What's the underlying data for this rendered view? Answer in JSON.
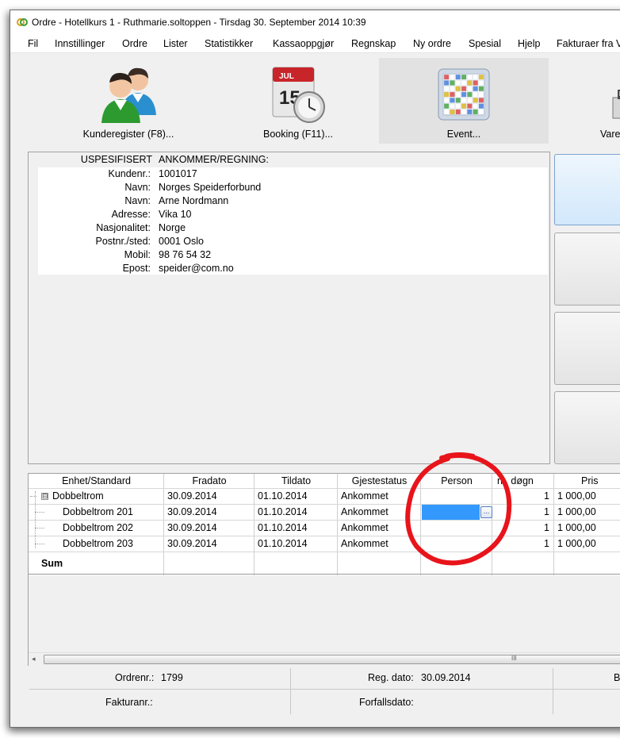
{
  "window": {
    "title": "Ordre - Hotellkurs 1 - Ruthmarie.soltoppen - Tirsdag 30. September 2014 10:39"
  },
  "menu": [
    "Fil",
    "Innstillinger",
    "Ordre",
    "Lister",
    "Statistikker",
    "Kassaoppgjør",
    "Regnskap",
    "Ny ordre",
    "Spesial",
    "Hjelp",
    "Fakturaer fra V"
  ],
  "toolbar": [
    {
      "label": "Kunderegister (F8)...",
      "icon": "users-icon"
    },
    {
      "label": "Booking (F11)...",
      "icon": "calendar-clock-icon",
      "month": "JUL",
      "day": "15"
    },
    {
      "label": "Event...",
      "icon": "event-grid-icon"
    },
    {
      "label": "Vare",
      "icon": "cash-register-icon"
    }
  ],
  "customer": {
    "header_label": "USPESIFISERT",
    "header_value": "ANKOMMER/REGNING:",
    "fields": [
      {
        "label": "Kundenr.:",
        "value": "1001017"
      },
      {
        "label": "Navn:",
        "value": "Norges Speiderforbund"
      },
      {
        "label": "Navn:",
        "value": "Arne Nordmann"
      },
      {
        "label": "Adresse:",
        "value": "Vika 10"
      },
      {
        "label": "Nasjonalitet:",
        "value": "Norge"
      },
      {
        "label": "Postnr./sted:",
        "value": "0001 Oslo"
      },
      {
        "label": "Mobil:",
        "value": "98 76 54 32"
      },
      {
        "label": "Epost:",
        "value": "speider@com.no"
      }
    ]
  },
  "grid": {
    "columns": [
      "Enhet/Standard",
      "Fradato",
      "Tildato",
      "Gjestestatus",
      "Person",
      "nt. døgn",
      "Pris"
    ],
    "rows": [
      {
        "unit": "Dobbeltrom",
        "from": "30.09.2014",
        "to": "01.10.2014",
        "status": "Ankommet",
        "person": "",
        "nights": "1",
        "price": "1 000,00"
      },
      {
        "unit": "Dobbeltrom 201",
        "from": "30.09.2014",
        "to": "01.10.2014",
        "status": "Ankommet",
        "person": "",
        "nights": "1",
        "price": "1 000,00"
      },
      {
        "unit": "Dobbeltrom 202",
        "from": "30.09.2014",
        "to": "01.10.2014",
        "status": "Ankommet",
        "person": "",
        "nights": "1",
        "price": "1 000,00"
      },
      {
        "unit": "Dobbeltrom 203",
        "from": "30.09.2014",
        "to": "01.10.2014",
        "status": "Ankommet",
        "person": "",
        "nights": "1",
        "price": "1 000,00"
      }
    ],
    "sum_label": "Sum",
    "expander_symbol": "⊟",
    "ellipsis": "...",
    "scroll_left": "◂",
    "scroll_grip": "III"
  },
  "footer": {
    "order_label": "Ordrenr.:",
    "order_value": "1799",
    "reg_label": "Reg. dato:",
    "reg_value": "30.09.2014",
    "invoice_label": "Fakturanr.:",
    "invoice_value": "",
    "due_label": "Forfallsdato:",
    "due_value": "",
    "third_label": "B"
  },
  "colors": {
    "selection": "#3399ff",
    "highlight_ring": "#e8141b"
  }
}
